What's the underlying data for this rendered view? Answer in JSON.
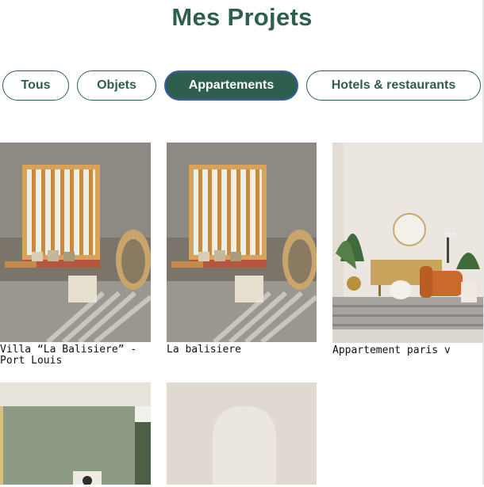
{
  "page": {
    "title": "Mes Projets"
  },
  "filters": [
    {
      "label": "Tous",
      "active": false
    },
    {
      "label": "Objets",
      "active": false
    },
    {
      "label": "Appartements",
      "active": true
    },
    {
      "label": "Hotels & restaurants",
      "active": false
    }
  ],
  "projects": [
    {
      "caption": "Villa “La Balisiere” - Port Louis"
    },
    {
      "caption": "La balisiere"
    },
    {
      "caption": "Appartement paris v"
    },
    {
      "caption": ""
    },
    {
      "caption": ""
    }
  ],
  "colors": {
    "accent": "#2e5e4e",
    "active_border": "#3a5ea8"
  }
}
